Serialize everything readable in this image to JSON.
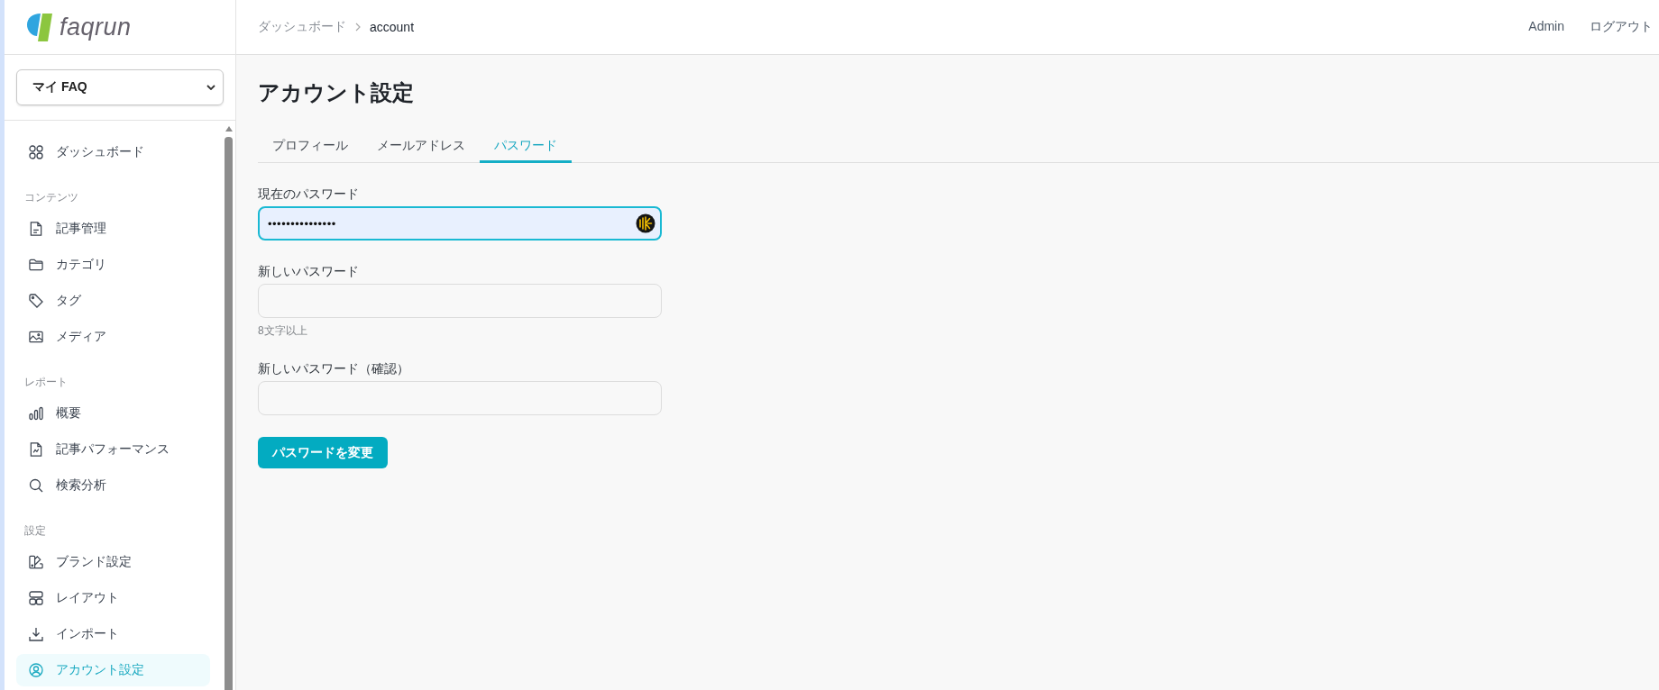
{
  "logo": {
    "text": "faqrun"
  },
  "sidebar": {
    "workspace_select": {
      "value": "マイ FAQ"
    },
    "groups": [
      {
        "items": [
          {
            "label": "ダッシュボード",
            "selected": false
          }
        ]
      },
      {
        "title": "コンテンツ",
        "items": [
          {
            "label": "記事管理",
            "selected": false
          },
          {
            "label": "カテゴリ",
            "selected": false
          },
          {
            "label": "タグ",
            "selected": false
          },
          {
            "label": "メディア",
            "selected": false
          }
        ]
      },
      {
        "title": "レポート",
        "items": [
          {
            "label": "概要",
            "selected": false
          },
          {
            "label": "記事パフォーマンス",
            "selected": false
          },
          {
            "label": "検索分析",
            "selected": false
          }
        ]
      },
      {
        "title": "設定",
        "items": [
          {
            "label": "ブランド設定",
            "selected": false
          },
          {
            "label": "レイアウト",
            "selected": false
          },
          {
            "label": "インポート",
            "selected": false
          },
          {
            "label": "アカウント設定",
            "selected": true
          }
        ]
      }
    ]
  },
  "header": {
    "breadcrumb": [
      {
        "label": "ダッシュボード",
        "current": false
      },
      {
        "label": "account",
        "current": true
      }
    ],
    "links": [
      "Admin",
      "ログアウト"
    ]
  },
  "page": {
    "title": "アカウント設定",
    "tabs": [
      {
        "label": "プロフィール",
        "selected": false
      },
      {
        "label": "メールアドレス",
        "selected": false
      },
      {
        "label": "パスワード",
        "selected": true
      }
    ],
    "form": {
      "fields": [
        {
          "label": "現在のパスワード",
          "value": "•••••••••••••••",
          "focused": true
        },
        {
          "label": "新しいパスワード",
          "hint": "8文字以上",
          "focused": false
        },
        {
          "label": "新しいパスワード（確認）",
          "focused": false
        }
      ],
      "submit": "パスワードを変更"
    }
  }
}
